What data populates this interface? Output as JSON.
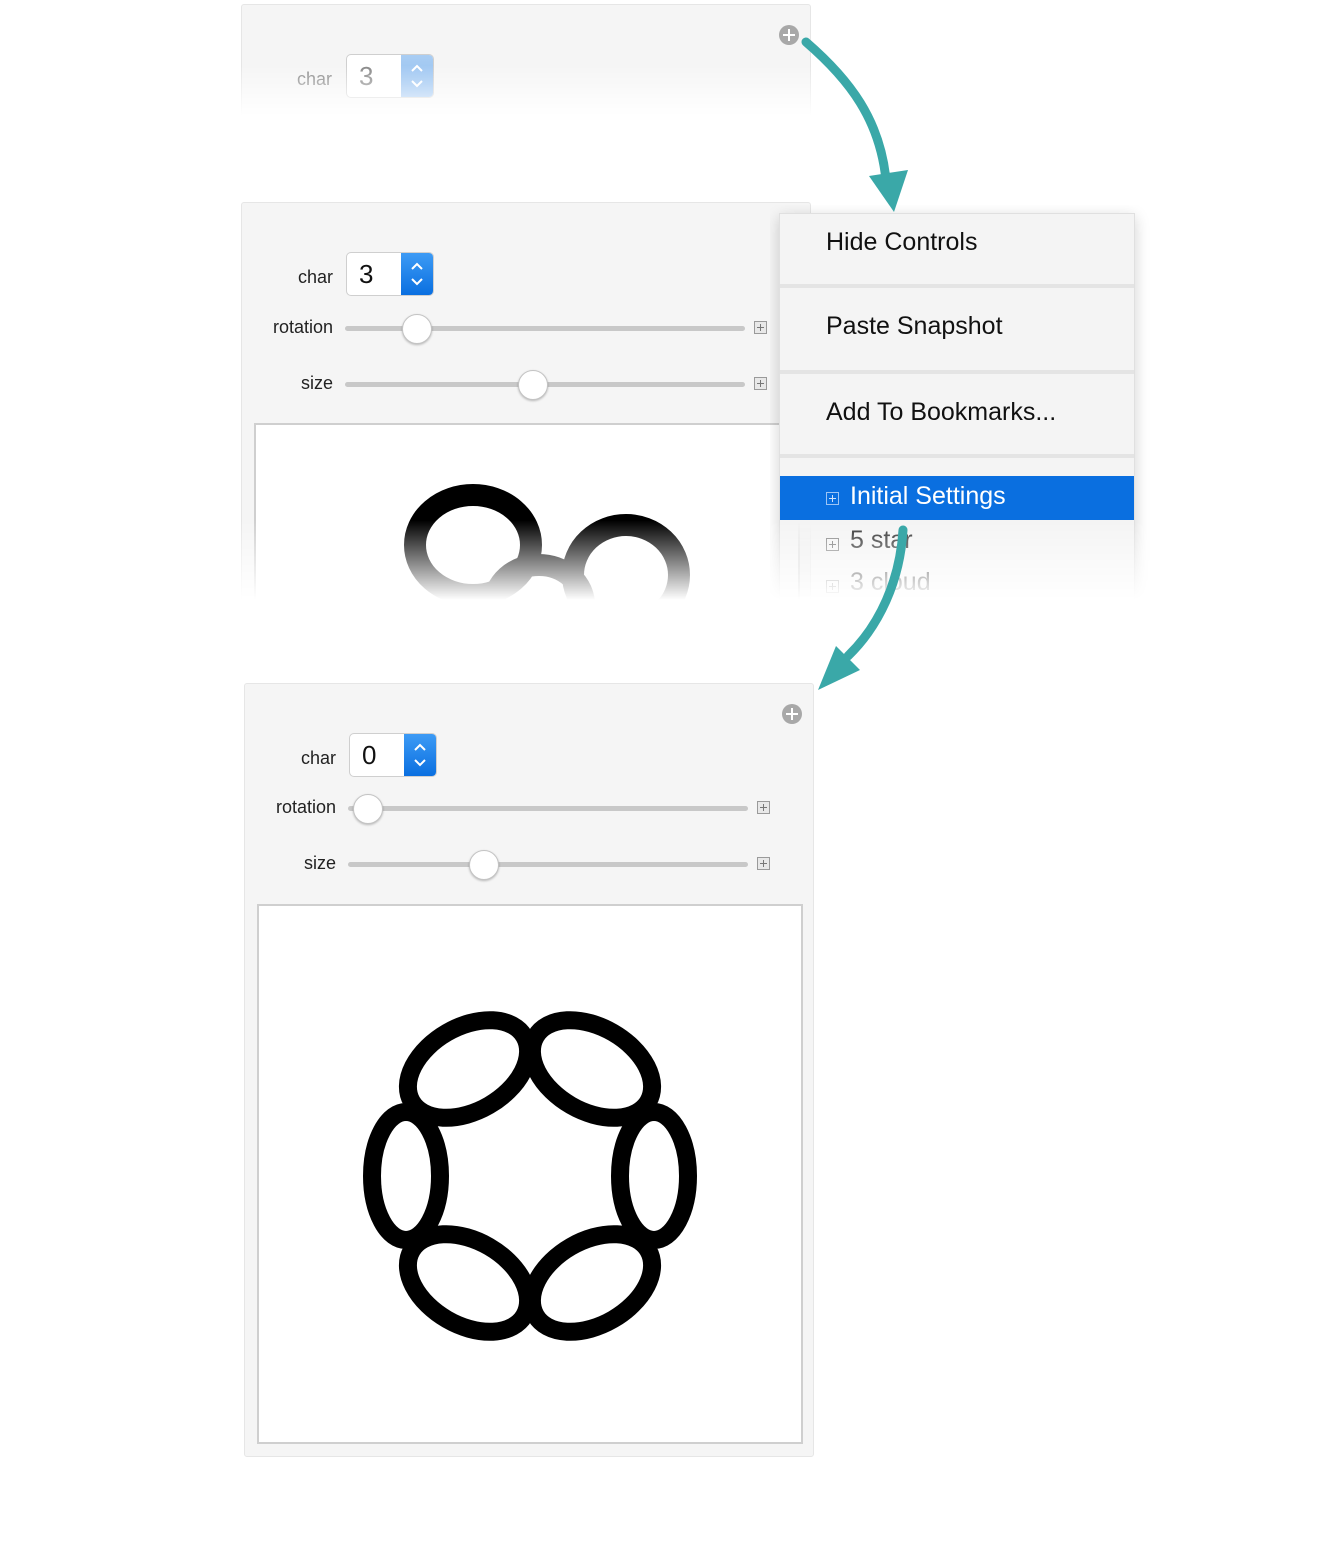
{
  "panel1": {
    "char_label": "char",
    "char_value": "3"
  },
  "panel2": {
    "char_label": "char",
    "char_value": "3",
    "rotation_label": "rotation",
    "rotation_level": 0.18,
    "size_label": "size",
    "size_level": 0.47
  },
  "context_menu": {
    "items": [
      "Hide Controls",
      "Paste Snapshot",
      "Add To Bookmarks..."
    ],
    "bookmarks": [
      "Initial Settings",
      "5 star",
      "3 cloud"
    ],
    "selected": "Initial Settings",
    "selected_color": "#0a6fe0"
  },
  "panel3": {
    "char_label": "char",
    "char_value": "0",
    "rotation_label": "rotation",
    "rotation_level": 0.05,
    "size_label": "size",
    "size_level": 0.34
  },
  "colors": {
    "arrow": "#3aa8a8",
    "spinner_blue": "#0a6fe0"
  }
}
